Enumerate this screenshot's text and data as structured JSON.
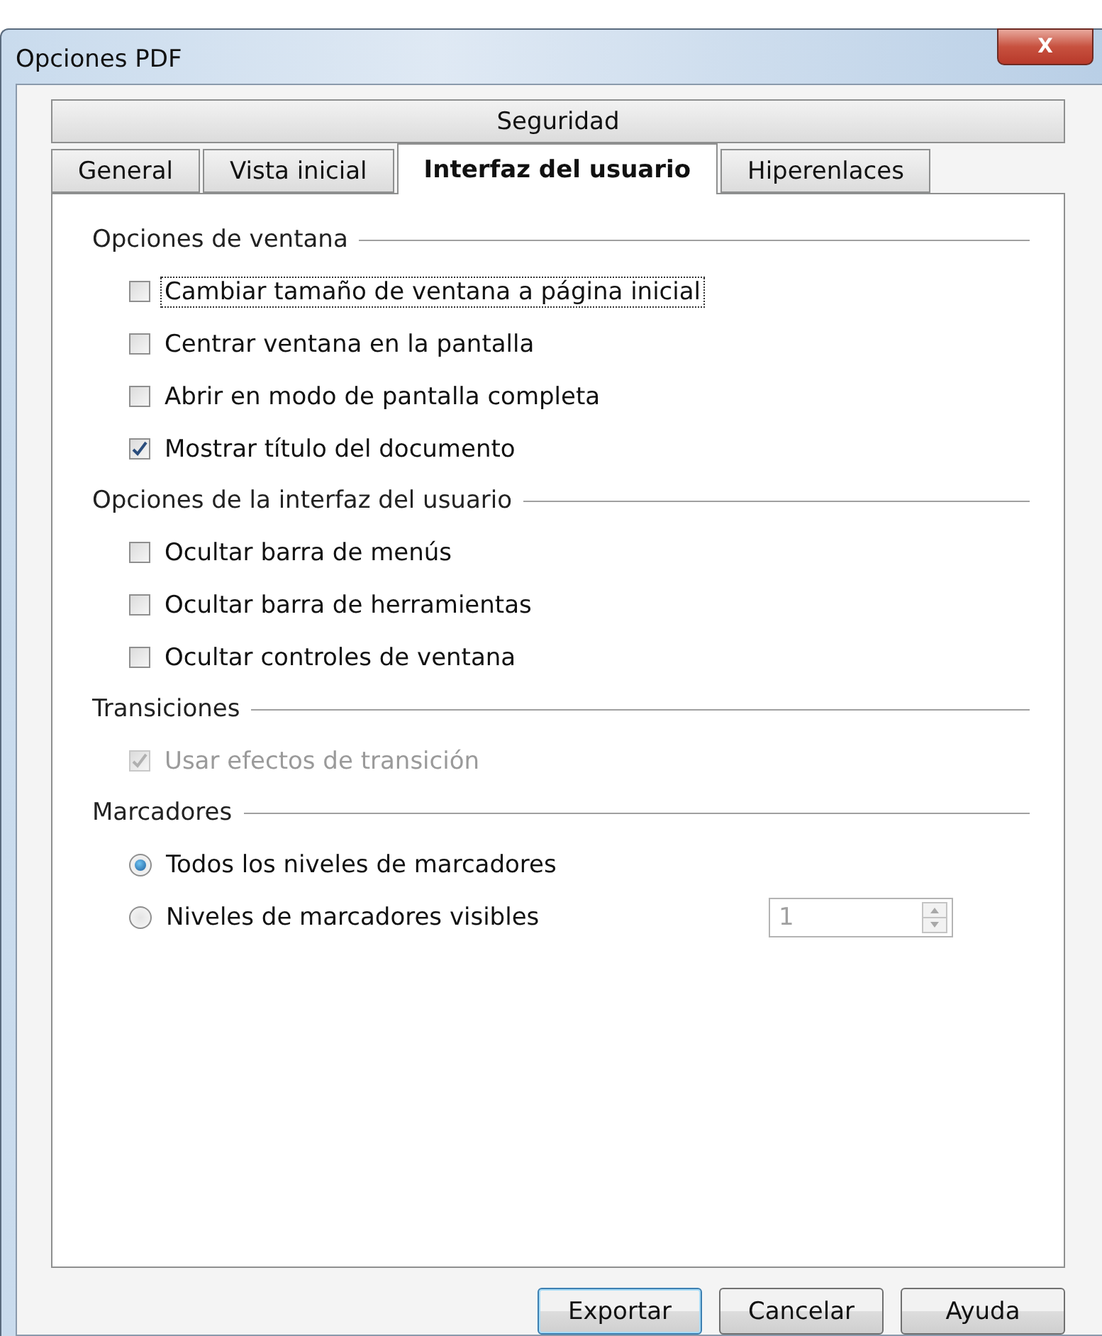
{
  "window": {
    "title": "Opciones PDF",
    "close_button": "X"
  },
  "tab_rows": [
    [
      {
        "label": "Seguridad",
        "selected": false
      }
    ],
    [
      {
        "label": "General",
        "selected": false
      },
      {
        "label": "Vista inicial",
        "selected": false
      },
      {
        "label": "Interfaz del usuario",
        "selected": true
      },
      {
        "label": "Hiperenlaces",
        "selected": false
      }
    ]
  ],
  "sections": [
    {
      "title": "Opciones de ventana",
      "items": [
        {
          "kind": "checkbox",
          "label": "Cambiar tamaño de ventana a página inicial",
          "checked": false,
          "disabled": false,
          "focused": true
        },
        {
          "kind": "checkbox",
          "label": "Centrar ventana en la pantalla",
          "checked": false,
          "disabled": false,
          "focused": false
        },
        {
          "kind": "checkbox",
          "label": "Abrir en modo de pantalla completa",
          "checked": false,
          "disabled": false,
          "focused": false
        },
        {
          "kind": "checkbox",
          "label": "Mostrar título del documento",
          "checked": true,
          "disabled": false,
          "focused": false
        }
      ]
    },
    {
      "title": "Opciones de la interfaz del usuario",
      "items": [
        {
          "kind": "checkbox",
          "label": "Ocultar barra de menús",
          "checked": false,
          "disabled": false,
          "focused": false
        },
        {
          "kind": "checkbox",
          "label": "Ocultar barra de herramientas",
          "checked": false,
          "disabled": false,
          "focused": false
        },
        {
          "kind": "checkbox",
          "label": "Ocultar controles de ventana",
          "checked": false,
          "disabled": false,
          "focused": false
        }
      ]
    },
    {
      "title": "Transiciones",
      "items": [
        {
          "kind": "checkbox",
          "label": "Usar efectos de transición",
          "checked": true,
          "disabled": true,
          "focused": false
        }
      ]
    },
    {
      "title": "Marcadores",
      "items": [
        {
          "kind": "radio",
          "label": "Todos los niveles de marcadores",
          "selected": true,
          "disabled": false,
          "focused": false
        },
        {
          "kind": "radio",
          "label": "Niveles de marcadores visibles",
          "selected": false,
          "disabled": false,
          "focused": false,
          "spin": {
            "value": "1",
            "disabled": true
          }
        }
      ]
    }
  ],
  "buttons": [
    {
      "label": "Exportar",
      "default": true
    },
    {
      "label": "Cancelar",
      "default": false
    },
    {
      "label": "Ayuda",
      "default": false
    }
  ]
}
